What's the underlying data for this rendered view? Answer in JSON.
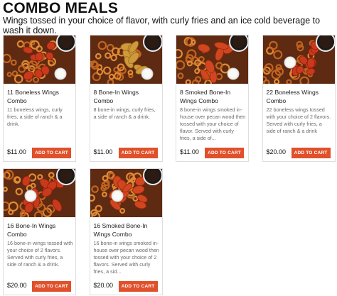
{
  "header": {
    "title": "COMBO MEALS",
    "subtitle": "Wings tossed in your choice of flavor, with curly fries and an ice cold beverage to wash it down."
  },
  "colors": {
    "button": "#e0502a",
    "price_text": "#111111",
    "description_text": "#6a6a6a"
  },
  "cart_label": "ADD TO CART",
  "items": [
    {
      "name": "11 Boneless Wings Combo",
      "description": "11 boneless wings, curly fries, a side of ranch & a drink.",
      "price": "$11.00",
      "image_kind": "boneless"
    },
    {
      "name": "8 Bone-In Wings Combo",
      "description": "8 bone-in wings, curly fries, a side of ranch & a drink.",
      "price": "$11.00",
      "image_kind": "bonein"
    },
    {
      "name": "8 Smoked Bone-In Wings Combo",
      "description": "8 bone-in wings smoked in-house over pecan wood then tossed with your choice of flavor. Served with curly fries, a side of...",
      "price": "$11.00",
      "image_kind": "smoked"
    },
    {
      "name": "22 Boneless Wings Combo",
      "description": "22 boneless wings tossed with your choice of 2 flavors. Served with curly fries, a side of ranch & a drink",
      "price": "$20.00",
      "image_kind": "boneless-large"
    },
    {
      "name": "16 Bone-In Wings Combo",
      "description": "16 bone-in wings tossed with your choice of 2 flavors. Served with curly fries, a side of ranch & a drink.",
      "price": "$20.00",
      "image_kind": "bonein-large"
    },
    {
      "name": "16 Smoked Bone-In Wings Combo",
      "description": "16 bone-in wings smoked in-house over pecan wood then tossed with your choice of 2 flavors. Served with curly fries, a sid...",
      "price": "$20.00",
      "image_kind": "smoked-large"
    }
  ]
}
